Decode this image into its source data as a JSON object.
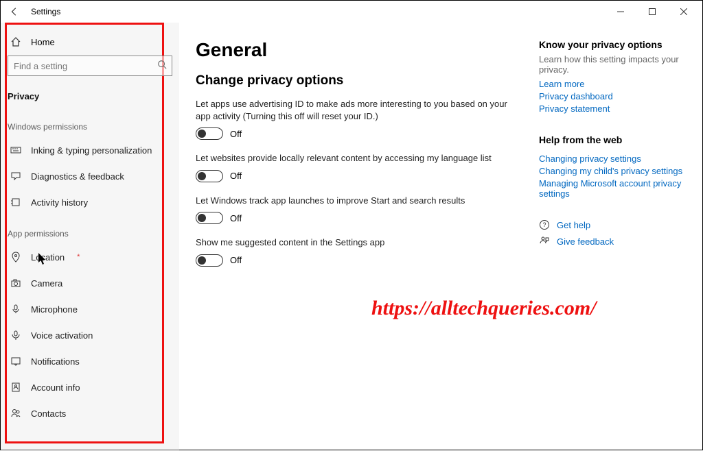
{
  "window": {
    "title": "Settings"
  },
  "sidebar": {
    "home": "Home",
    "search_placeholder": "Find a setting",
    "category": "Privacy",
    "group_windows": "Windows permissions",
    "group_app": "App permissions",
    "items_windows": [
      {
        "label": "Inking & typing personalization"
      },
      {
        "label": "Diagnostics & feedback"
      },
      {
        "label": "Activity history"
      }
    ],
    "items_app": [
      {
        "label": "Location",
        "flagged": true
      },
      {
        "label": "Camera"
      },
      {
        "label": "Microphone"
      },
      {
        "label": "Voice activation"
      },
      {
        "label": "Notifications"
      },
      {
        "label": "Account info"
      },
      {
        "label": "Contacts"
      }
    ]
  },
  "main": {
    "title": "General",
    "subtitle": "Change privacy options",
    "settings": [
      {
        "desc": "Let apps use advertising ID to make ads more interesting to you based on your app activity (Turning this off will reset your ID.)",
        "state": "Off"
      },
      {
        "desc": "Let websites provide locally relevant content by accessing my language list",
        "state": "Off"
      },
      {
        "desc": "Let Windows track app launches to improve Start and search results",
        "state": "Off"
      },
      {
        "desc": "Show me suggested content in the Settings app",
        "state": "Off"
      }
    ]
  },
  "aside": {
    "know_title": "Know your privacy options",
    "know_desc": "Learn how this setting impacts your privacy.",
    "know_links": [
      "Learn more",
      "Privacy dashboard",
      "Privacy statement"
    ],
    "help_title": "Help from the web",
    "help_links": [
      "Changing privacy settings",
      "Changing my child's privacy settings",
      "Managing Microsoft account privacy settings"
    ],
    "get_help": "Get help",
    "give_feedback": "Give feedback"
  },
  "watermark": "https://alltechqueries.com/"
}
